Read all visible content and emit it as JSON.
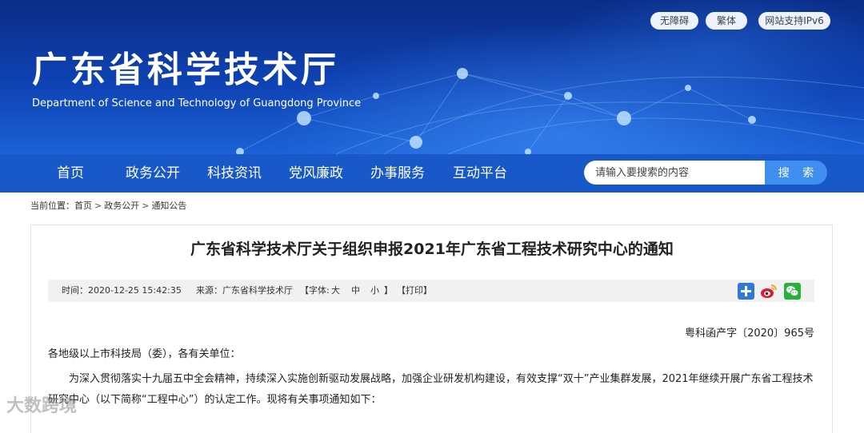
{
  "header": {
    "site_title": "广东省科学技术厅",
    "site_subtitle": "Department of Science and Technology of Guangdong Province",
    "accessibility_label": "无障碍",
    "traditional_label": "繁体",
    "ipv6_label": "网站支持IPv6"
  },
  "nav": {
    "items": [
      "首页",
      "政务公开",
      "科技资讯",
      "党风廉政",
      "办事服务",
      "互动平台"
    ],
    "search_placeholder": "请输入要搜索的内容",
    "search_button": "搜 索"
  },
  "breadcrumb": {
    "prefix": "当前位置：",
    "items": [
      "首页",
      "政务公开",
      "通知公告"
    ],
    "separator": ">"
  },
  "article": {
    "title": "广东省科学技术厅关于组织申报2021年广东省工程技术研究中心的通知",
    "meta": {
      "time": "时间：2020-12-25 15:42:35",
      "source": "来源：广东省科学技术厅",
      "font_label": "【字体:",
      "font_large": "大",
      "font_medium": "中",
      "font_small": "小",
      "font_close": "】",
      "print": "【打印】"
    },
    "share_icons": [
      "share-plus-icon",
      "weibo-icon",
      "wechat-icon"
    ],
    "doc_number": "粤科函产字〔2020〕965号",
    "salutation": "各地级以上市科技局（委），各有关单位：",
    "paragraph": "为深入贯彻落实十九届五中全会精神，持续深入实施创新驱动发展战略，加强企业研发机构建设，有效支撑“双十”产业集群发展，2021年继续开展广东省工程技术研究中心（以下简称“工程中心”）的认定工作。现将有关事项通知如下："
  },
  "watermark": "大数跨境",
  "colors": {
    "banner_dark": "#0a2c86",
    "nav_bg": "#1858c9",
    "search_button_bg": "#3f8ff0",
    "meta_bar_bg": "#f1f1f1"
  }
}
